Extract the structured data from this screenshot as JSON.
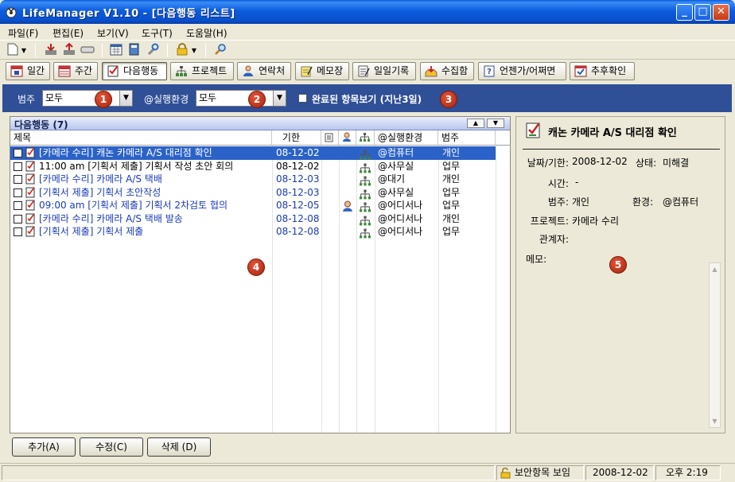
{
  "window": {
    "title": "LifeManager V1.10 - [다음행동 리스트]"
  },
  "menu": [
    "파일(F)",
    "편집(E)",
    "보기(V)",
    "도구(T)",
    "도움말(H)"
  ],
  "nav": [
    {
      "label": "일간"
    },
    {
      "label": "주간"
    },
    {
      "label": "다음행동"
    },
    {
      "label": "프로젝트"
    },
    {
      "label": "연락처"
    },
    {
      "label": "메모장"
    },
    {
      "label": "일일기록"
    },
    {
      "label": "수집함"
    },
    {
      "label": "언젠가/어쩌면"
    },
    {
      "label": "추후확인"
    }
  ],
  "filter": {
    "category_label": "범주",
    "category_value": "모두",
    "context_label": "@실행환경",
    "context_value": "모두",
    "completed_label": "완료된 항목보기 (지난3일)"
  },
  "badges": [
    "1",
    "2",
    "3",
    "4",
    "5"
  ],
  "list": {
    "title": "다음행동 (7)",
    "columns": {
      "title": "제목",
      "due": "기한",
      "context": "@실행환경",
      "category": "범주"
    },
    "rows": [
      {
        "title": "[카메라 수리] 캐논 카메라 A/S 대리점 확인",
        "due": "08-12-02",
        "context": "@컴퓨터",
        "category": "개인",
        "selected": true,
        "blue": true,
        "person": false
      },
      {
        "title": "11:00 am [기획서 제출] 기획서 작성 초안 회의",
        "due": "08-12-02",
        "context": "@사무실",
        "category": "업무",
        "selected": false,
        "blue": false,
        "person": false
      },
      {
        "title": "[카메라 수리] 카메라 A/S 택배",
        "due": "08-12-03",
        "context": "@대기",
        "category": "개인",
        "selected": false,
        "blue": true,
        "person": false
      },
      {
        "title": "[기획서 제출] 기획서 초안작성",
        "due": "08-12-03",
        "context": "@사무실",
        "category": "업무",
        "selected": false,
        "blue": true,
        "person": false
      },
      {
        "title": "09:00 am [기획서 제출] 기획서 2차검토 협의",
        "due": "08-12-05",
        "context": "@어디서나",
        "category": "업무",
        "selected": false,
        "blue": true,
        "person": true
      },
      {
        "title": "[카메라 수리] 카메라 A/S 택배 발송",
        "due": "08-12-08",
        "context": "@어디서나",
        "category": "개인",
        "selected": false,
        "blue": true,
        "person": false
      },
      {
        "title": "[기획서 제출] 기획서 제출",
        "due": "08-12-08",
        "context": "@어디서나",
        "category": "업무",
        "selected": false,
        "blue": true,
        "person": false
      }
    ]
  },
  "detail": {
    "title": "캐논 카메라 A/S 대리점 확인",
    "date_label": "날짜/기한:",
    "date_value": "2008-12-02",
    "status_label": "상태:",
    "status_value": "미해결",
    "time_label": "시간:",
    "time_value": "-",
    "category_label": "범주:",
    "category_value": "개인",
    "env_label": "환경:",
    "env_value": "@컴퓨터",
    "project_label": "프로젝트:",
    "project_value": "카메라 수리",
    "people_label": "관계자:",
    "memo_label": "메모:"
  },
  "buttons": {
    "add": "추가(A)",
    "edit": "수정(C)",
    "delete": "삭제 (D)"
  },
  "status": {
    "secure": "보안항목 보임",
    "date": "2008-12-02",
    "time": "오후 2:19"
  }
}
